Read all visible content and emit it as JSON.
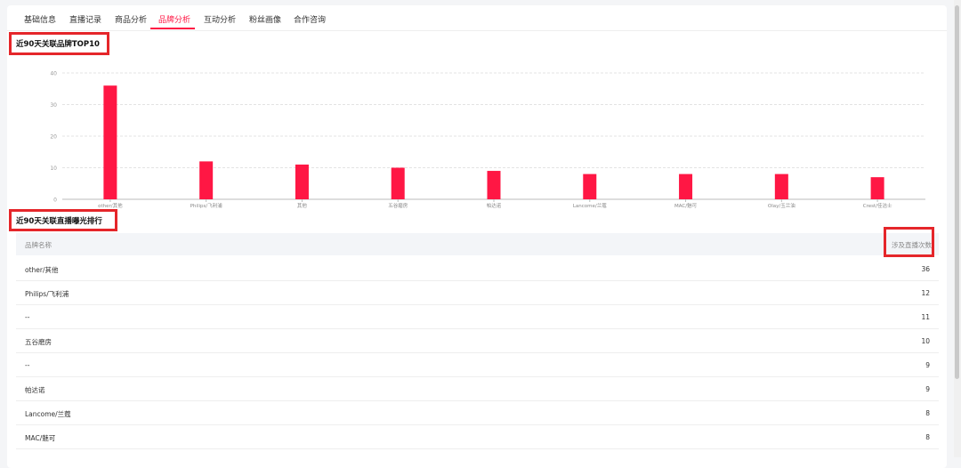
{
  "tabs": [
    {
      "label": "基础信息"
    },
    {
      "label": "直播记录"
    },
    {
      "label": "商品分析"
    },
    {
      "label": "品牌分析",
      "active": true
    },
    {
      "label": "互动分析"
    },
    {
      "label": "粉丝画像"
    },
    {
      "label": "合作咨询"
    }
  ],
  "section1_title": "近90天关联品牌TOP10",
  "section2_title": "近90天关联直播曝光排行",
  "table": {
    "col_name": "品牌名称",
    "col_count": "涉及直播次数",
    "rows": [
      {
        "name": "other/其他",
        "count": "36"
      },
      {
        "name": "Philips/飞利浦",
        "count": "12"
      },
      {
        "name": "--",
        "count": "11"
      },
      {
        "name": "五谷磨房",
        "count": "10"
      },
      {
        "name": "--",
        "count": "9"
      },
      {
        "name": "帕达诺",
        "count": "9"
      },
      {
        "name": "Lancome/兰蔻",
        "count": "8"
      },
      {
        "name": "MAC/魅可",
        "count": "8"
      }
    ]
  },
  "colors": {
    "accent": "#ff1744",
    "highlight_box": "#e5262a"
  },
  "chart_data": {
    "type": "bar",
    "categories": [
      "other/其他",
      "Philips/飞利浦",
      "其他",
      "五谷磨房",
      "帕达诺",
      "Lancome/兰蔻",
      "MAC/魅可",
      "Olay/玉兰油",
      "Crest/佳洁士"
    ],
    "values": [
      36,
      12,
      11,
      10,
      9,
      8,
      8,
      8,
      7
    ],
    "yticks": [
      0,
      10,
      20,
      30,
      40
    ],
    "ylim": [
      0,
      40
    ],
    "grid": true,
    "title": "",
    "xlabel": "",
    "ylabel": ""
  }
}
